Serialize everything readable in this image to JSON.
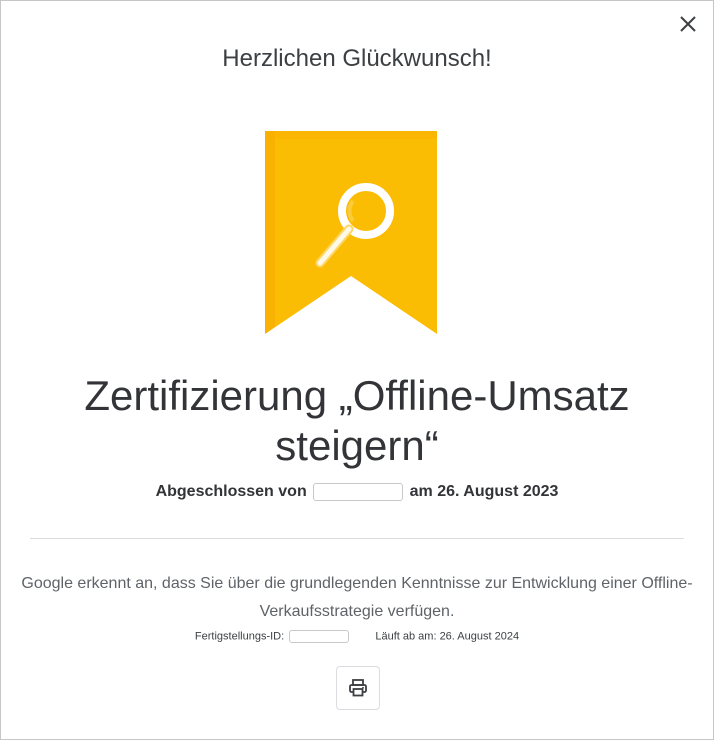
{
  "dialog": {
    "heading": "Herzlichen Glückwunsch!",
    "close_icon": "close-icon"
  },
  "badge": {
    "icon": "magnifier-icon",
    "color": "#fbbc04",
    "shadow_color": "#f9ab00"
  },
  "certificate": {
    "title": "Zertifizierung „Offline-Umsatz steigern“",
    "completed_prefix": "Abgeschlossen von",
    "completed_suffix": "am 26. August 2023",
    "description": "Google erkennt an, dass Sie über die grundlegenden Kenntnisse zur Entwicklung einer Offline-Verkaufsstrategie verfügen.",
    "completion_id_label": "Fertigstellungs-ID:",
    "expires_label": "Läuft ab am: 26. August 2024"
  },
  "actions": {
    "print_icon": "printer-icon"
  }
}
